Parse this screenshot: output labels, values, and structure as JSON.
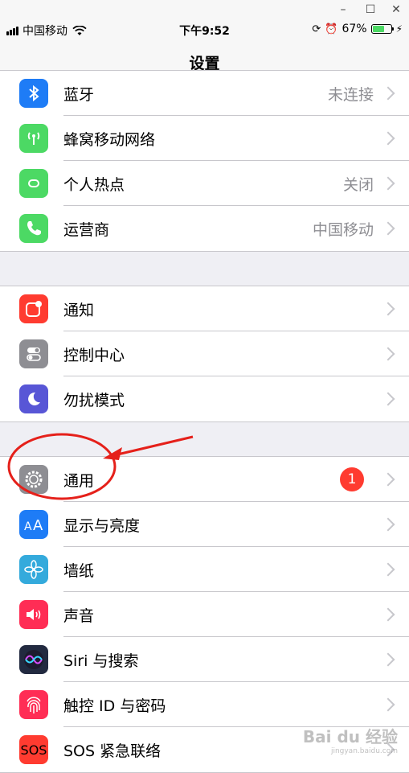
{
  "window": {
    "minimize": "–",
    "maximize": "☐",
    "close": "✕"
  },
  "status": {
    "carrier": "中国移动",
    "time": "下午9:52",
    "battery": "67%",
    "battery_level": 0.67
  },
  "nav": {
    "title": "设置"
  },
  "groups": [
    [
      {
        "label": "蓝牙",
        "value": "未连接",
        "icon": "bluetooth-icon",
        "color": "#1e7cf6"
      },
      {
        "label": "蜂窝移动网络",
        "value": "",
        "icon": "cellular-icon",
        "color": "#4cd964"
      },
      {
        "label": "个人热点",
        "value": "关闭",
        "icon": "hotspot-icon",
        "color": "#4cd964"
      },
      {
        "label": "运营商",
        "value": "中国移动",
        "icon": "phone-icon",
        "color": "#4cd964"
      }
    ],
    [
      {
        "label": "通知",
        "value": "",
        "icon": "notifications-icon",
        "color": "#ff3b30"
      },
      {
        "label": "控制中心",
        "value": "",
        "icon": "control-center-icon",
        "color": "#8e8e93"
      },
      {
        "label": "勿扰模式",
        "value": "",
        "icon": "moon-icon",
        "color": "#5856d6"
      }
    ],
    [
      {
        "label": "通用",
        "value": "",
        "badge": "1",
        "icon": "gear-icon",
        "color": "#8e8e93"
      },
      {
        "label": "显示与亮度",
        "value": "",
        "icon": "display-icon",
        "color": "#1e7cf6"
      },
      {
        "label": "墙纸",
        "value": "",
        "icon": "wallpaper-icon",
        "color": "#34aadc"
      },
      {
        "label": "声音",
        "value": "",
        "icon": "sound-icon",
        "color": "#ff2d55"
      },
      {
        "label": "Siri 与搜索",
        "value": "",
        "icon": "siri-icon",
        "color": "#222a40"
      },
      {
        "label": "触控 ID 与密码",
        "value": "",
        "icon": "fingerprint-icon",
        "color": "#ff2d55"
      },
      {
        "label": "SOS 紧急联络",
        "value": "",
        "icon": "sos-icon",
        "color": "#ff3b30",
        "icon_text": "SOS"
      }
    ]
  ],
  "watermark": {
    "text": "Bai du 经验",
    "sub": "jingyan.baidu.com"
  }
}
